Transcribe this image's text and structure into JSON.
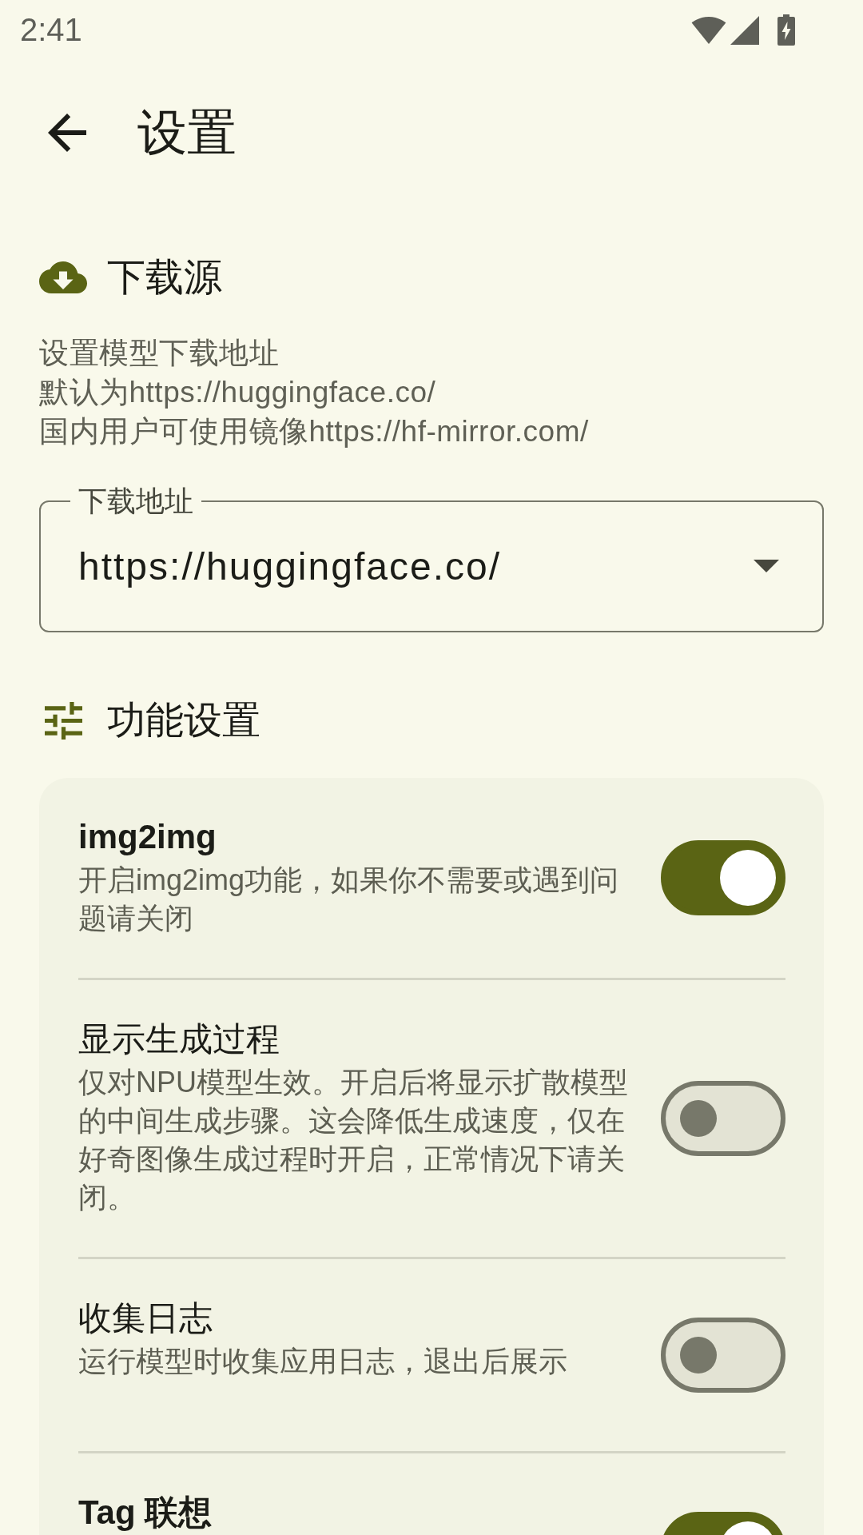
{
  "status_bar": {
    "time": "2:41"
  },
  "app_bar": {
    "title": "设置"
  },
  "sections": [
    {
      "kind": "download_source",
      "title": "下载源",
      "description": [
        "设置模型下载地址",
        "默认为https://huggingface.co/",
        "国内用户可使用镜像https://hf-mirror.com/"
      ],
      "field": {
        "label": "下载地址",
        "value": "https://huggingface.co/"
      }
    },
    {
      "kind": "features",
      "title": "功能设置",
      "settings": [
        {
          "title": "img2img",
          "subtitle": "开启img2img功能，如果你不需要或遇到问题请关闭",
          "on": true
        },
        {
          "title": "显示生成过程",
          "subtitle": "仅对NPU模型生效。开启后将显示扩散模型的中间生成步骤。这会降低生成速度，仅在好奇图像生成过程时开启，正常情况下请关闭。",
          "on": false
        },
        {
          "title": "收集日志",
          "subtitle": "运行模型时收集应用日志，退出后展示",
          "on": false
        },
        {
          "title": "Tag 联想",
          "on": true
        }
      ]
    }
  ]
}
